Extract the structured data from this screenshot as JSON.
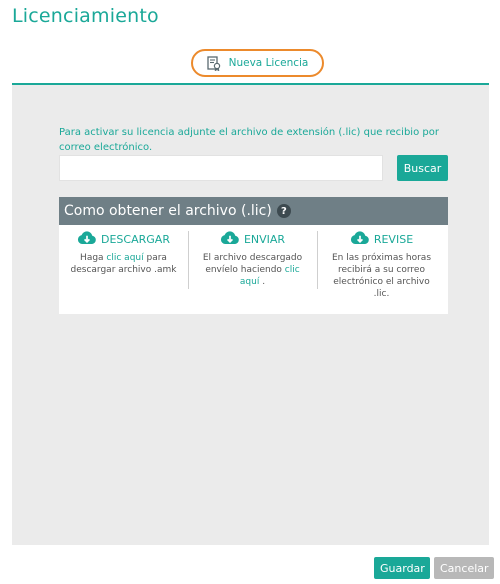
{
  "page_title": "Licenciamiento",
  "tabs": [
    {
      "label": "Nueva Licencia",
      "icon": "certificate-icon"
    }
  ],
  "instructions": "Para activar su licencia adjunte el archivo de extensión (.lic) que recibio por correo electrónico.",
  "file_input": {
    "value": "",
    "placeholder": ""
  },
  "search_button": "Buscar",
  "howto": {
    "title": "Como obtener el archivo (.lic)",
    "help": "?",
    "steps": [
      {
        "title": "DESCARGAR",
        "icon": "cloud-download-icon",
        "text_before": "Haga ",
        "link": "clic aquí",
        "text_after": " para descargar archivo .amk"
      },
      {
        "title": "ENVIAR",
        "icon": "cloud-download-icon",
        "text_before": "El archivo descargado envíelo haciendo ",
        "link": "clic aquí",
        "text_after": " ."
      },
      {
        "title": "REVISE",
        "icon": "cloud-download-icon",
        "text_before": "En las próximas horas recibirá a su correo electrónico el archivo .lic.",
        "link": "",
        "text_after": ""
      }
    ]
  },
  "footer": {
    "save_label": "Guardar",
    "cancel_label": "Cancelar"
  },
  "colors": {
    "accent": "#1aa898",
    "tab_highlight": "#ec8a2c",
    "header_bar": "#6f7f86",
    "panel_bg": "#ebebeb",
    "cancel_bg": "#b8b8b8"
  }
}
